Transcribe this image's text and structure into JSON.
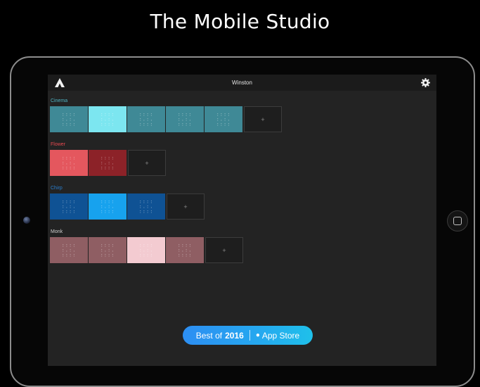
{
  "banner": {
    "title": "The Mobile Studio"
  },
  "app": {
    "title": "Winston"
  },
  "icons": {
    "logo": "winston-logo-icon",
    "settings": "gear-icon",
    "add": "plus-icon",
    "back": "chevron-left-icon",
    "home": "home-button-icon"
  },
  "groups": [
    {
      "label": "Cinema",
      "label_color": "#4fb6c6",
      "swatches": [
        "#3f8996",
        "#7ce6f0",
        "#3f8996",
        "#3f8996",
        "#3f8996"
      ]
    },
    {
      "label": "Flower",
      "label_color": "#e5484f",
      "swatches": [
        "#e4575e",
        "#8c2228"
      ]
    },
    {
      "label": "Chirp",
      "label_color": "#2a7fd0",
      "swatches": [
        "#0f5294",
        "#17a2ee",
        "#0f5294"
      ]
    },
    {
      "label": "Monk",
      "label_color": "#cfcfcf",
      "swatches": [
        "#8f5e63",
        "#8f5e63",
        "#f3cbd1",
        "#8f5e63"
      ]
    }
  ],
  "add_label": "+",
  "badge": {
    "prefix": "Best of",
    "year": "2016",
    "store": "App Store"
  }
}
